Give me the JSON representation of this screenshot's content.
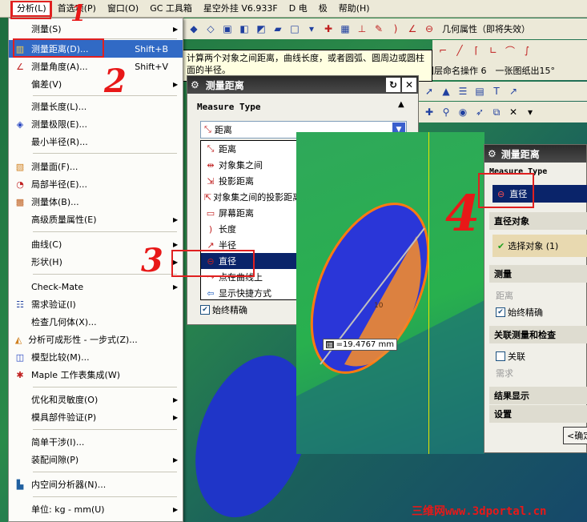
{
  "menubar": {
    "items": [
      "分析(L)",
      "首选项(P)",
      "窗口(O)",
      "GC 工具箱",
      "星空外挂 V6.933F",
      "D 电",
      "极",
      "帮助(H)"
    ]
  },
  "toolbar": {
    "geometry_attr": "几何属性（即将失效）",
    "layer_naming": "图层命名操作 6",
    "one_sheet": "一张图纸出15°"
  },
  "tooltip": {
    "text": "计算两个对象之间距离，曲线长度，或者圆弧、圆周边或圆柱面的半径。"
  },
  "menu": {
    "items": [
      {
        "label": "测量(S)",
        "shortcut": "",
        "arrow": "▶"
      },
      {
        "label": "测量距离(D)...",
        "shortcut": "Shift+B",
        "arrow": ""
      },
      {
        "label": "测量角度(A)...",
        "shortcut": "Shift+V",
        "arrow": ""
      },
      {
        "label": "偏差(V)",
        "shortcut": "",
        "arrow": "▶"
      },
      {
        "label": "测量长度(L)...",
        "shortcut": "",
        "arrow": ""
      },
      {
        "label": "测量极限(E)...",
        "shortcut": "",
        "arrow": ""
      },
      {
        "label": "最小半径(R)...",
        "shortcut": "",
        "arrow": ""
      },
      {
        "label": "测量面(F)...",
        "shortcut": "",
        "arrow": ""
      },
      {
        "label": "局部半径(E)...",
        "shortcut": "",
        "arrow": ""
      },
      {
        "label": "测量体(B)...",
        "shortcut": "",
        "arrow": ""
      },
      {
        "label": "高级质量属性(E)",
        "shortcut": "",
        "arrow": "▶"
      },
      {
        "label": "曲线(C)",
        "shortcut": "",
        "arrow": "▶"
      },
      {
        "label": "形状(H)",
        "shortcut": "",
        "arrow": "▶"
      },
      {
        "label": "Check-Mate",
        "shortcut": "",
        "arrow": "▶"
      },
      {
        "label": "需求验证(I)",
        "shortcut": "",
        "arrow": ""
      },
      {
        "label": "检查几何体(X)...",
        "shortcut": "",
        "arrow": ""
      },
      {
        "label": "分析可成形性 - 一步式(Z)...",
        "shortcut": "",
        "arrow": ""
      },
      {
        "label": "模型比较(M)...",
        "shortcut": "",
        "arrow": ""
      },
      {
        "label": "Maple 工作表集成(W)",
        "shortcut": "",
        "arrow": ""
      },
      {
        "label": "优化和灵敏度(O)",
        "shortcut": "",
        "arrow": "▶"
      },
      {
        "label": "模具部件验证(P)",
        "shortcut": "",
        "arrow": "▶"
      },
      {
        "label": "简单干涉(I)...",
        "shortcut": "",
        "arrow": ""
      },
      {
        "label": "装配间隙(P)",
        "shortcut": "",
        "arrow": "▶"
      },
      {
        "label": "内空间分析器(N)...",
        "shortcut": "",
        "arrow": ""
      },
      {
        "label": "单位: kg - mm(U)",
        "shortcut": "",
        "arrow": "▶"
      }
    ]
  },
  "dialog1": {
    "title": "测量距离",
    "section_label": "Measure Type",
    "selected": "距离",
    "options": [
      "距离",
      "对象集之间",
      "投影距离",
      "对象集之间的投影距离",
      "屏幕距离",
      "长度",
      "半径",
      "直径",
      "点在曲线上",
      "显示快捷方式"
    ],
    "checkbox_label": "始终精确"
  },
  "viewport": {
    "measurement": "=19.4767 mm",
    "tick_label": "10"
  },
  "dialog2": {
    "title": "测量距离",
    "section_label": "Measure Type",
    "type_value": "直径",
    "object_section": "直径对象",
    "select_object": "选择对象 (1)",
    "measure_section": "测量",
    "distance_label": "距离",
    "always_exact": "始终精确",
    "assoc_section": "关联测量和检查",
    "assoc_label": "关联",
    "require_label": "需求",
    "result_section": "结果显示",
    "settings_section": "设置",
    "ok_button": "<确定"
  },
  "annotations": {
    "n1": "1",
    "n2": "2",
    "n3": "3",
    "n4": "4"
  },
  "watermark": "三维网www.3dportal.cn"
}
